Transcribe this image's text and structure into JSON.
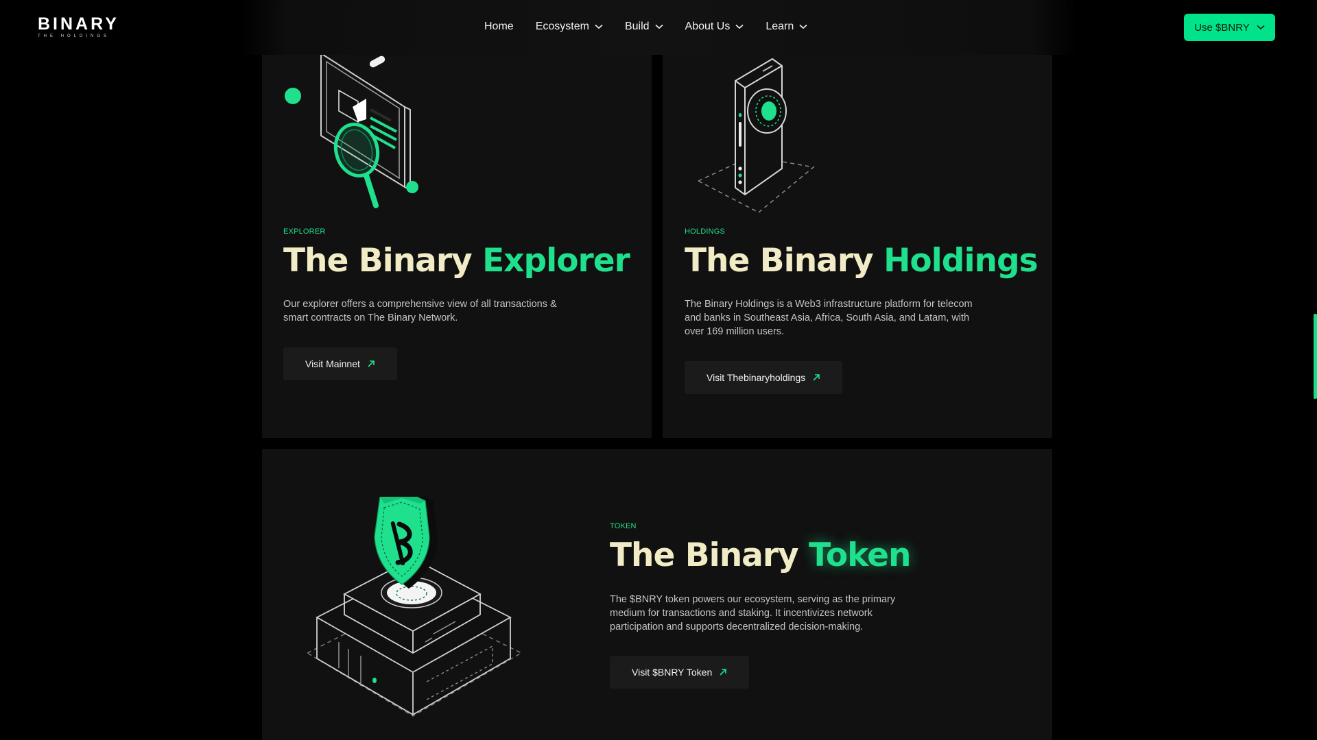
{
  "nav": {
    "logo_main": "BINARY",
    "logo_sub": "The Holdings",
    "items": [
      {
        "label": "Home",
        "dropdown": false
      },
      {
        "label": "Ecosystem",
        "dropdown": true
      },
      {
        "label": "Build",
        "dropdown": true
      },
      {
        "label": "About Us",
        "dropdown": true
      },
      {
        "label": "Learn",
        "dropdown": true
      }
    ],
    "cta_label": "Use $BNRY"
  },
  "cards": [
    {
      "eyebrow": "EXPLORER",
      "title_main": "The Binary ",
      "title_accent": "Explorer",
      "description": "Our explorer offers a comprehensive view of all transactions & smart contracts on The Binary Network.",
      "button_label": "Visit Mainnet",
      "illustration": "magnifier-screen-illustration"
    },
    {
      "eyebrow": "HOLDINGS",
      "title_main": "The Binary ",
      "title_accent": "Holdings",
      "description": "The Binary Holdings is a Web3 infrastructure platform for telecom and banks in Southeast Asia, Africa, South Asia, and Latam, with over 169 million users.",
      "button_label": "Visit Thebinaryholdings",
      "illustration": "phone-camera-illustration"
    },
    {
      "eyebrow": "TOKEN",
      "title_main": "The Binary ",
      "title_accent": "Token",
      "description": "The $BNRY token powers our ecosystem, serving as the primary medium for transactions and staking. It incentivizes network participation and supports decentralized decision-making.",
      "button_label": "Visit $BNRY Token",
      "illustration": "shield-on-chip-illustration"
    }
  ],
  "colors": {
    "accent": "#1fe08c",
    "cta": "#00e38a",
    "title": "#f1ecc6",
    "card_bg": "#111111",
    "page_bg": "#000000"
  }
}
